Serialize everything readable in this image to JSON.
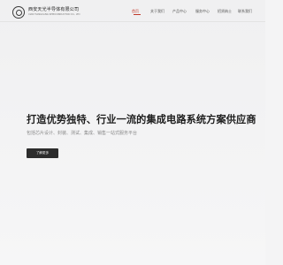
{
  "header": {
    "company_name": "西安天光半导体有限公司",
    "company_name_en": "XIAN TIANGUANG SEMICONDUCTOR CO., LTD"
  },
  "nav": {
    "items": [
      {
        "label": "首页",
        "active": true
      },
      {
        "label": "关于我们",
        "active": false
      },
      {
        "label": "产品中心",
        "active": false
      },
      {
        "label": "服务中心",
        "active": false
      },
      {
        "label": "招贤纳士",
        "active": false
      },
      {
        "label": "联系我们",
        "active": false
      }
    ]
  },
  "hero": {
    "headline": "打造优势独特、行业一流的集成电路系统方案供应商",
    "subline": "包括芯片设计、封装、测试、集成、销售一站式服务平台",
    "cta_label": "了解更多"
  },
  "colors": {
    "accent": "#c0392b",
    "button_bg": "#2d2d2d",
    "background": "#f4f4f5"
  }
}
